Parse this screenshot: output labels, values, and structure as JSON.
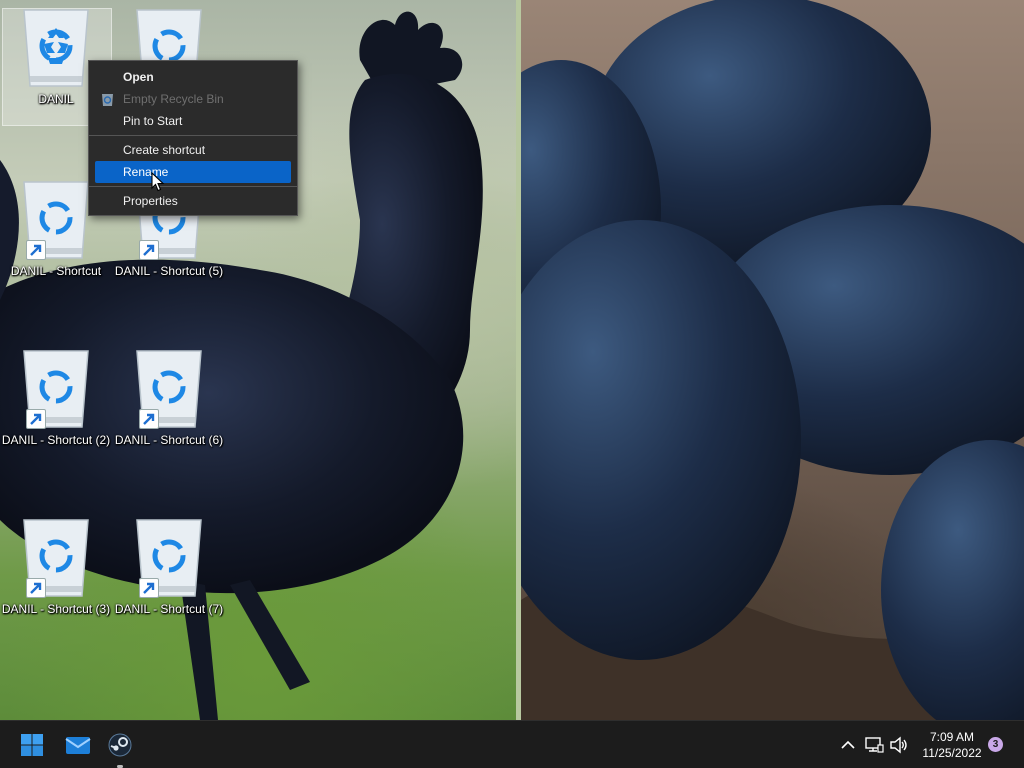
{
  "desktop": {
    "icons": [
      {
        "label": "DANIL",
        "icon": "recycle-bin-icon",
        "shortcut": false,
        "selected": true
      },
      {
        "label": "",
        "icon": "recycle-bin-icon",
        "shortcut": true,
        "selected": false
      },
      {
        "label": "DANIL - Shortcut",
        "icon": "recycle-bin-icon",
        "shortcut": true,
        "selected": false
      },
      {
        "label": "DANIL - Shortcut (5)",
        "icon": "recycle-bin-icon",
        "shortcut": true,
        "selected": false
      },
      {
        "label": "DANIL - Shortcut (2)",
        "icon": "recycle-bin-icon",
        "shortcut": true,
        "selected": false
      },
      {
        "label": "DANIL - Shortcut (6)",
        "icon": "recycle-bin-icon",
        "shortcut": true,
        "selected": false
      },
      {
        "label": "DANIL - Shortcut (3)",
        "icon": "recycle-bin-icon",
        "shortcut": true,
        "selected": false
      },
      {
        "label": "DANIL - Shortcut (7)",
        "icon": "recycle-bin-icon",
        "shortcut": true,
        "selected": false
      }
    ]
  },
  "context_menu": {
    "items": [
      {
        "label": "Open",
        "bold": true,
        "disabled": false,
        "highlighted": false
      },
      {
        "label": "Empty Recycle Bin",
        "bold": false,
        "disabled": true,
        "highlighted": false,
        "icon": "recycle-bin-icon"
      },
      {
        "label": "Pin to Start",
        "bold": false,
        "disabled": false,
        "highlighted": false
      },
      {
        "label": "Create shortcut",
        "bold": false,
        "disabled": false,
        "highlighted": false
      },
      {
        "label": "Rename",
        "bold": false,
        "disabled": false,
        "highlighted": true
      },
      {
        "label": "Properties",
        "bold": false,
        "disabled": false,
        "highlighted": false
      }
    ]
  },
  "taskbar": {
    "apps": [
      {
        "name": "start-button",
        "icon": "windows-logo-icon"
      },
      {
        "name": "mail-button",
        "icon": "mail-icon"
      },
      {
        "name": "steam-button",
        "icon": "steam-icon",
        "running": true
      }
    ],
    "tray": {
      "icons": [
        "chevron-up-icon",
        "network-icon",
        "volume-icon"
      ],
      "time": "7:09 AM",
      "date": "11/25/2022",
      "notification_count": "3"
    }
  },
  "colors": {
    "menu_bg": "#2b2b2b",
    "menu_highlight": "#0a64c8",
    "taskbar_bg": "#1c1c1c",
    "recycle_blue": "#1e88e5",
    "badge": "#c9a8e8"
  }
}
